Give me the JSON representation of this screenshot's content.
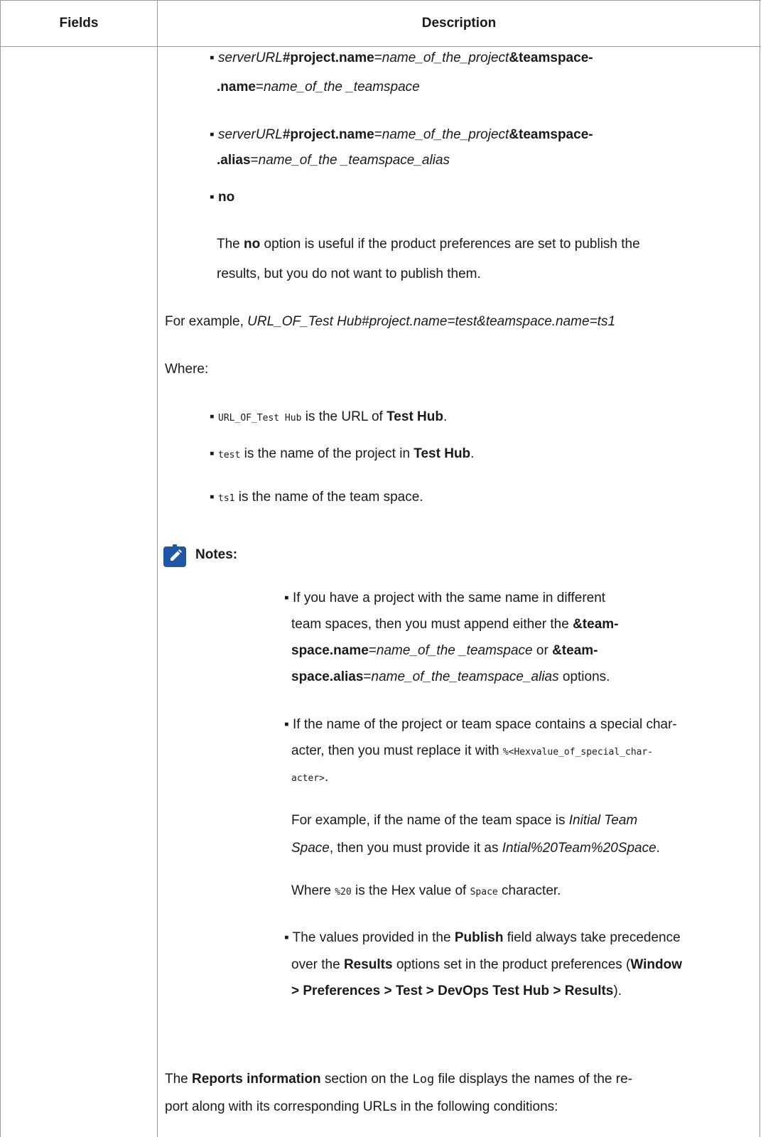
{
  "table": {
    "header": {
      "fields": "Fields",
      "description": "Description"
    }
  },
  "bullets_top": {
    "b1": {
      "bullet": "▪",
      "part1": "serverURL",
      "part2": "#",
      "part3": "project.name",
      "part4": "=",
      "part5": "name_of_the_project",
      "part6": "&teamspace-",
      "part7": ".name",
      "part8": "=",
      "part9": "name_of_the _teamspace"
    },
    "b2": {
      "bullet": "▪",
      "part1": "serverURL",
      "part2": "#",
      "part3": "project.name",
      "part4": "=",
      "part5": "name_of_the_project",
      "part6": "&teamspace-",
      "part7": ".alias",
      "part8": "=",
      "part9": "name_of_the _teamspace_alias"
    },
    "b3": {
      "bullet": "▪",
      "label": "no"
    }
  },
  "no_para": {
    "a": "The ",
    "b": "no",
    "c": " option is useful if the product preferences are set to publish the",
    "line2": "results, but you do not want to publish them."
  },
  "example": {
    "a": "For example, ",
    "b": "URL_OF_Test Hub#project.name=test&teamspace.name=ts1"
  },
  "where": "Where:",
  "where_items": [
    {
      "code": "URL_OF_Test Hub",
      "text": " is the URL of ",
      "bold": "Test Hub",
      "end": "."
    },
    {
      "code": "test",
      "text": " is the name of the project in ",
      "bold": "Test Hub",
      "end": "."
    },
    {
      "code": "ts1",
      "text": " is the name of the team space.",
      "bold": "",
      "end": ""
    }
  ],
  "notes": {
    "title": "Notes:",
    "n1": {
      "l1": "If you have a project with the same name in different",
      "l2a": "team spaces, then you must append either the ",
      "l2b": "&team-",
      "l3a": "space.name",
      "l3b": "=",
      "l3c": "name_of_the _teamspace",
      "l3d": " or ",
      "l3e": "&team-",
      "l4a": "space.alias",
      "l4b": "=",
      "l4c": "name_of_the_teamspace_alias",
      "l4d": " options."
    },
    "n2": {
      "l1": "If the name of the project or team space contains a special char-",
      "l2a": "acter, then you must replace it with ",
      "l2b": "%<Hexvalue_of_special_char-",
      "l3a": "acter>",
      "l3b": ".",
      "p1a": "For example, if the name of the team space is ",
      "p1b": "Initial Team",
      "p2a": "Space",
      "p2b": ", then you must provide it as ",
      "p2c": "Intial%20Team%20Space",
      "p2d": ".",
      "w1": "Where ",
      "w2": "%20",
      "w3": " is the Hex value of ",
      "w4": "Space",
      "w5": " character."
    },
    "n3": {
      "l1a": "The values provided in the ",
      "l1b": "Publish",
      "l1c": " field always take precedence",
      "l2a": "over the ",
      "l2b": "Results",
      "l2c": " options set in the product preferences (",
      "l2d": "Window",
      "l3a": "> Preferences > Test > DevOps Test Hub > Results",
      "l3b": ")."
    }
  },
  "reports": {
    "l1a": "The ",
    "l1b": "Reports information",
    "l1c": " section on the ",
    "l1d": "Log",
    "l1e": " file displays the names of the re-",
    "l2": "port along with its corresponding URLs in the following conditions:"
  }
}
